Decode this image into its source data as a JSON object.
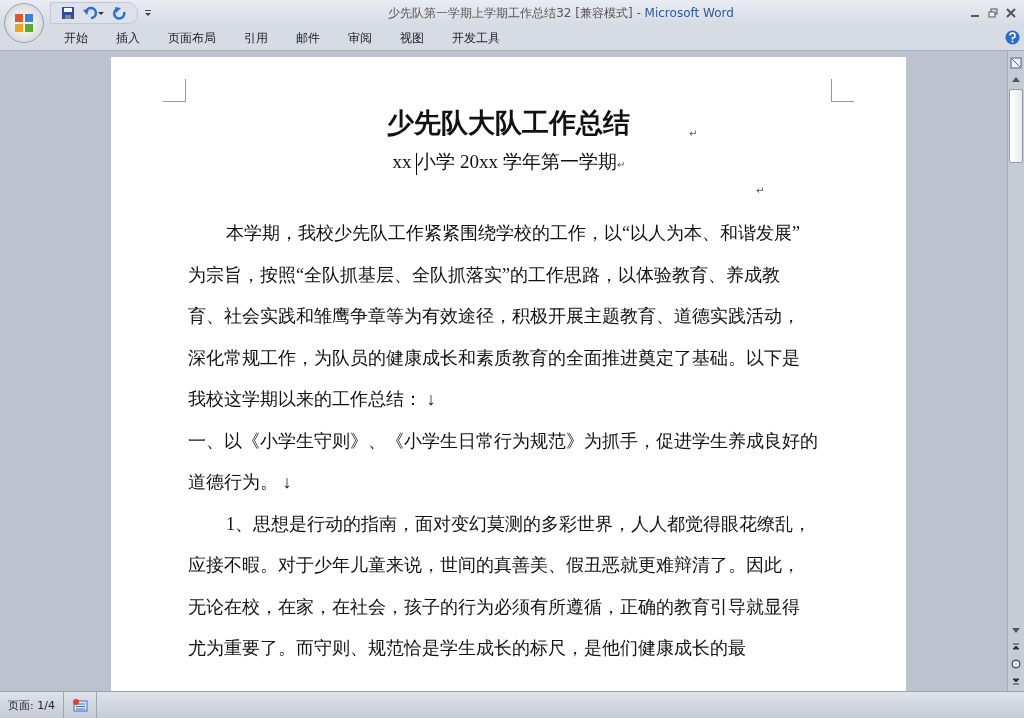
{
  "window": {
    "title": "少先队第一学期上学期工作总结32 [兼容模式]",
    "separator": "-",
    "app": "Microsoft Word"
  },
  "ribbon_tabs": [
    {
      "label": "开始",
      "selected": false
    },
    {
      "label": "插入",
      "selected": false
    },
    {
      "label": "页面布局",
      "selected": false
    },
    {
      "label": "引用",
      "selected": false
    },
    {
      "label": "邮件",
      "selected": false
    },
    {
      "label": "审阅",
      "selected": false
    },
    {
      "label": "视图",
      "selected": false
    },
    {
      "label": "开发工具",
      "selected": false
    }
  ],
  "document": {
    "title": "少先队大队工作总结",
    "title_mark": "↵",
    "subtitle_before_cursor": "xx ",
    "subtitle_after_cursor": "小学 20xx 学年第一学期",
    "subtitle_mark": "↵",
    "empty_mark": "↵",
    "paragraphs": [
      {
        "indent": true,
        "lines": [
          "本学期，我校少先队工作紧紧围绕学校的工作，以“以人为本、和谐发展”",
          "为宗旨，按照“全队抓基层、全队抓落实”的工作思路，以体验教育、养成教",
          "育、社会实践和雏鹰争章等为有效途径，积极开展主题教育、道德实践活动，",
          "深化常规工作，为队员的健康成长和素质教育的全面推进奠定了基础。以下是",
          "我校这学期以来的工作总结： ↓"
        ]
      },
      {
        "indent": false,
        "lines": [
          "一、以《小学生守则》、《小学生日常行为规范》为抓手，促进学生养成良好的",
          "道德行为。 ↓"
        ]
      },
      {
        "indent": true,
        "lines": [
          "1、思想是行动的指南，面对变幻莫测的多彩世界，人人都觉得眼花缭乱，",
          "应接不暇。对于少年儿童来说，世间的真善美、假丑恶就更难辩清了。因此，",
          "无论在校，在家，在社会，孩子的行为必须有所遵循，正确的教育引导就显得",
          "尤为重要了。而守则、规范恰是学生成长的标尺，是他们健康成长的最"
        ]
      }
    ]
  },
  "status_bar": {
    "page": "页面: 1/4"
  }
}
